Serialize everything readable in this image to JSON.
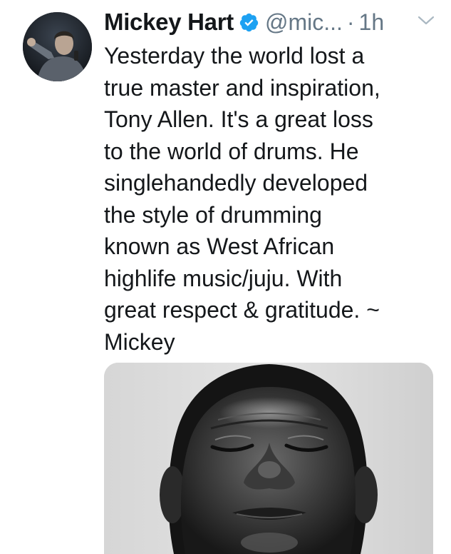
{
  "tweet": {
    "author_name": "Mickey Hart",
    "handle": "@mic...",
    "separator": "·",
    "time": "1h",
    "text_lines": [
      "Yesterday the world lost a",
      "true master and inspiration,",
      "Tony Allen. It's a great loss",
      "to the world of drums. He",
      "singlehandedly developed",
      "the style of drumming",
      "known as West African",
      "highlife music/juju. With",
      "great respect & gratitude. ~",
      "Mickey"
    ]
  },
  "icons": {
    "verified": "verified-badge-icon",
    "menu": "chevron-down-icon"
  },
  "colors": {
    "text": "#14171a",
    "secondary": "#657786",
    "verified": "#1da1f2"
  }
}
